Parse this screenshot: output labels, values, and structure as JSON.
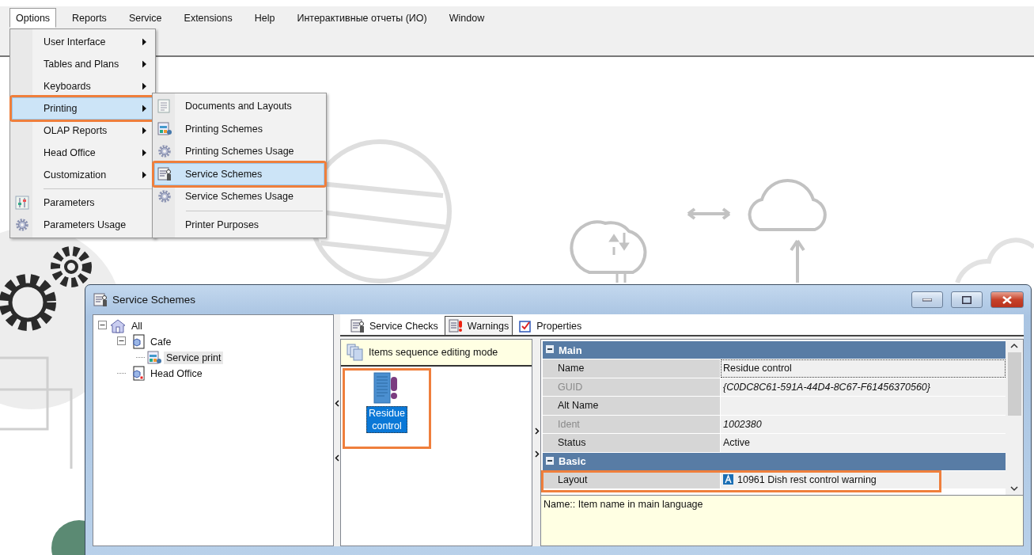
{
  "menubar": [
    {
      "label": "Options",
      "selected": true
    },
    {
      "label": "Reports",
      "selected": false
    },
    {
      "label": "Service",
      "selected": false
    },
    {
      "label": "Extensions",
      "selected": false
    },
    {
      "label": "Help",
      "selected": false
    },
    {
      "label": "Интерактивные отчеты (ИО)",
      "selected": false
    },
    {
      "label": "Window",
      "selected": false
    }
  ],
  "options_menu": [
    {
      "label": "User Interface",
      "kind": "submenu",
      "selected": false,
      "highlighted": false
    },
    {
      "label": "Tables and Plans",
      "kind": "submenu",
      "selected": false,
      "highlighted": false
    },
    {
      "label": "Keyboards",
      "kind": "submenu",
      "selected": false,
      "highlighted": false
    },
    {
      "label": "Printing",
      "kind": "submenu",
      "selected": true,
      "highlighted": true
    },
    {
      "label": "OLAP Reports",
      "kind": "submenu",
      "selected": false,
      "highlighted": false
    },
    {
      "label": "Head Office",
      "kind": "submenu",
      "selected": false,
      "highlighted": false
    },
    {
      "label": "Customization",
      "kind": "submenu",
      "selected": false,
      "highlighted": false
    },
    {
      "label": "Parameters",
      "kind": "parameters",
      "separator_before": true,
      "selected": false,
      "highlighted": false
    },
    {
      "label": "Parameters Usage",
      "kind": "usage",
      "selected": false,
      "highlighted": false
    }
  ],
  "printing_submenu": [
    {
      "label": "Documents and Layouts",
      "kind": "document",
      "selected": false,
      "highlighted": false
    },
    {
      "label": "Printing Schemes",
      "kind": "scheme",
      "selected": false,
      "highlighted": false
    },
    {
      "label": "Printing Schemes Usage",
      "kind": "usage",
      "selected": false,
      "highlighted": false
    },
    {
      "label": "Service Schemes",
      "kind": "service",
      "selected": true,
      "highlighted": true
    },
    {
      "label": "Service Schemes Usage",
      "kind": "usage",
      "selected": false,
      "highlighted": false
    },
    {
      "label": "Printer Purposes",
      "kind": "plain",
      "separator_before": true,
      "selected": false,
      "highlighted": false
    }
  ],
  "window": {
    "title": "Service Schemes"
  },
  "tree": [
    {
      "label": "All",
      "kind": "root",
      "expanded": true,
      "selected": false,
      "children": [
        {
          "label": "Cafe",
          "kind": "restaurant",
          "expanded": true,
          "selected": false,
          "children": [
            {
              "label": "Service print",
              "kind": "scheme",
              "selected": true
            }
          ]
        },
        {
          "label": "Head Office",
          "kind": "office",
          "selected": false
        }
      ]
    }
  ],
  "tabs": [
    {
      "label": "Service Checks",
      "kind": "checks",
      "selected": false
    },
    {
      "label": "Warnings",
      "kind": "warnings",
      "selected": true
    },
    {
      "label": "Properties",
      "kind": "properties",
      "selected": false
    }
  ],
  "sequence_panel": {
    "header": "Items sequence editing mode",
    "items": [
      {
        "label": "Residue control",
        "selected": true,
        "highlighted": true
      }
    ]
  },
  "property_grid": {
    "categories": [
      {
        "name": "Main",
        "expanded": true,
        "rows": [
          {
            "name": "Name",
            "value": "Residue control",
            "kind": "text",
            "disabled": false,
            "focused": true,
            "highlighted": false
          },
          {
            "name": "GUID",
            "value": "{C0DC8C61-591A-44D4-8C67-F61456370560}",
            "kind": "text",
            "disabled": true,
            "focused": false,
            "highlighted": false
          },
          {
            "name": "Alt Name",
            "kind": "text",
            "disabled": false,
            "focused": false,
            "highlighted": false
          },
          {
            "name": "Ident",
            "value": "1002380",
            "kind": "text",
            "disabled": true,
            "focused": false,
            "highlighted": false
          },
          {
            "name": "Status",
            "value": "Active",
            "kind": "text",
            "disabled": false,
            "focused": false,
            "highlighted": false
          }
        ]
      },
      {
        "name": "Basic",
        "expanded": true,
        "rows": [
          {
            "name": "Layout",
            "value": "10961 Dish rest control warning",
            "kind": "reference",
            "disabled": false,
            "focused": false,
            "highlighted": true
          }
        ]
      }
    ]
  },
  "description": "Name:: Item name in main language"
}
